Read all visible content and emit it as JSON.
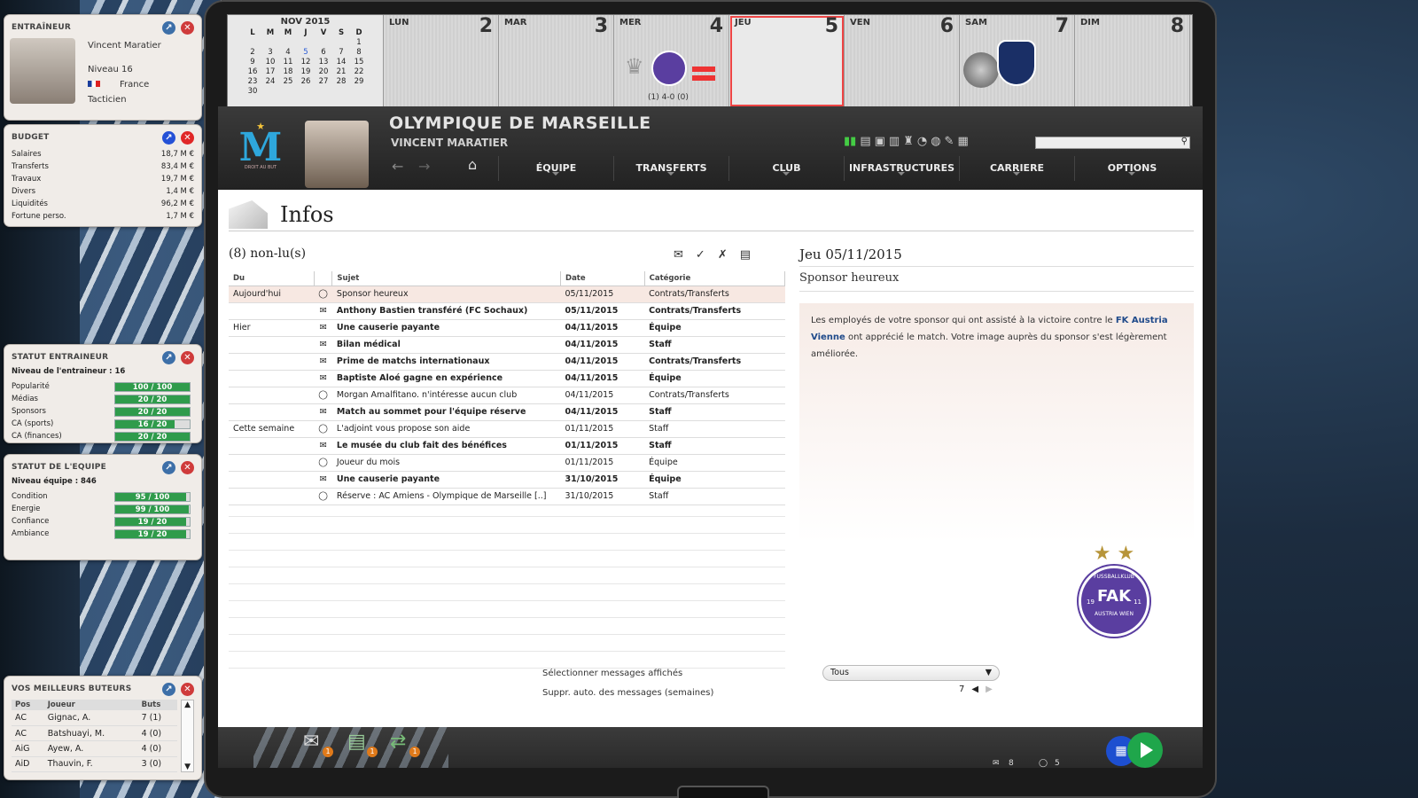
{
  "coach": {
    "title": "ENTRAÎNEUR",
    "name": "Vincent Maratier",
    "level": "Niveau 16",
    "country": "France",
    "role": "Tacticien"
  },
  "budget": {
    "title": "BUDGET",
    "rows": [
      {
        "label": "Salaires",
        "value": "18,7 M €"
      },
      {
        "label": "Transferts",
        "value": "83,4 M €"
      },
      {
        "label": "Travaux",
        "value": "19,7 M €"
      },
      {
        "label": "Divers",
        "value": "1,4 M €"
      },
      {
        "label": "Liquidités",
        "value": "96,2 M €"
      },
      {
        "label": "Fortune perso.",
        "value": "1,7 M €"
      }
    ]
  },
  "coach_status": {
    "title": "STATUT ENTRAINEUR",
    "subtitle": "Niveau de l'entraineur : 16",
    "rows": [
      {
        "label": "Popularité",
        "text": "100 / 100",
        "fraction": 1.0
      },
      {
        "label": "Médias",
        "text": "20 / 20",
        "fraction": 1.0
      },
      {
        "label": "Sponsors",
        "text": "20 / 20",
        "fraction": 1.0
      },
      {
        "label": "CA (sports)",
        "text": "16 / 20",
        "fraction": 0.8
      },
      {
        "label": "CA (finances)",
        "text": "20 / 20",
        "fraction": 1.0
      }
    ]
  },
  "team_status": {
    "title": "STATUT DE L'EQUIPE",
    "subtitle": "Niveau équipe : 846",
    "rows": [
      {
        "label": "Condition",
        "text": "95 / 100",
        "fraction": 0.95
      },
      {
        "label": "Energie",
        "text": "99 / 100",
        "fraction": 0.99
      },
      {
        "label": "Confiance",
        "text": "19 / 20",
        "fraction": 0.95
      },
      {
        "label": "Ambiance",
        "text": "19 / 20",
        "fraction": 0.95
      }
    ]
  },
  "scorers": {
    "title": "VOS MEILLEURS BUTEURS",
    "headers": [
      "Pos",
      "Joueur",
      "Buts"
    ],
    "rows": [
      {
        "pos": "AC",
        "name": "Gignac, A.",
        "goals": "7 (1)"
      },
      {
        "pos": "AC",
        "name": "Batshuayi, M.",
        "goals": "4 (0)"
      },
      {
        "pos": "AiG",
        "name": "Ayew, A.",
        "goals": "4 (0)"
      },
      {
        "pos": "AiD",
        "name": "Thauvin, F.",
        "goals": "3 (0)"
      }
    ]
  },
  "calendar": {
    "month": "NOV 2015",
    "weekdays": [
      "L",
      "M",
      "M",
      "J",
      "V",
      "S",
      "D"
    ],
    "weeks": [
      [
        "",
        "",
        "",
        "",
        "",
        "",
        "1"
      ],
      [
        "2",
        "3",
        "4",
        "5",
        "6",
        "7",
        "8"
      ],
      [
        "9",
        "10",
        "11",
        "12",
        "13",
        "14",
        "15"
      ],
      [
        "16",
        "17",
        "18",
        "19",
        "20",
        "21",
        "22"
      ],
      [
        "23",
        "24",
        "25",
        "26",
        "27",
        "28",
        "29"
      ],
      [
        "30",
        "",
        "",
        "",
        "",
        "",
        ""
      ]
    ],
    "days": [
      {
        "name": "LUN",
        "num": "2"
      },
      {
        "name": "MAR",
        "num": "3"
      },
      {
        "name": "MER",
        "num": "4"
      },
      {
        "name": "JEU",
        "num": "5"
      },
      {
        "name": "VEN",
        "num": "6"
      },
      {
        "name": "SAM",
        "num": "7"
      },
      {
        "name": "DIM",
        "num": "8"
      }
    ],
    "match_score": "(1) 4-0 (0)"
  },
  "header": {
    "club": "OLYMPIQUE DE MARSEILLE",
    "manager": "VINCENT MARATIER",
    "crest_text": "DROIT AU BUT",
    "nav": [
      "ÉQUIPE",
      "TRANSFERTS",
      "CLUB",
      "INFRASTRUCTURES",
      "CARRIERE",
      "OPTIONS"
    ]
  },
  "inbox": {
    "title": "Infos",
    "unread": "(8) non-lu(s)",
    "headers": [
      "Du",
      "Sujet",
      "Date",
      "Catégorie"
    ],
    "rows": [
      {
        "group": "Aujourd'hui",
        "icon": "◯",
        "subject": "Sponsor heureux",
        "date": "05/11/2015",
        "category": "Contrats/Transferts",
        "bold": false,
        "sel": true
      },
      {
        "group": "",
        "icon": "✉",
        "subject": "Anthony Bastien transféré (FC Sochaux)",
        "date": "05/11/2015",
        "category": "Contrats/Transferts",
        "bold": true
      },
      {
        "group": "Hier",
        "icon": "✉",
        "subject": "Une causerie payante",
        "date": "04/11/2015",
        "category": "Équipe",
        "bold": true
      },
      {
        "group": "",
        "icon": "✉",
        "subject": "Bilan médical",
        "date": "04/11/2015",
        "category": "Staff",
        "bold": true
      },
      {
        "group": "",
        "icon": "✉",
        "subject": "Prime de matchs internationaux",
        "date": "04/11/2015",
        "category": "Contrats/Transferts",
        "bold": true
      },
      {
        "group": "",
        "icon": "✉",
        "subject": "Baptiste Aloé gagne en expérience",
        "date": "04/11/2015",
        "category": "Équipe",
        "bold": true
      },
      {
        "group": "",
        "icon": "◯",
        "subject": "Morgan Amalfitano. n'intéresse aucun club",
        "date": "04/11/2015",
        "category": "Contrats/Transferts",
        "bold": false
      },
      {
        "group": "",
        "icon": "✉",
        "subject": "Match au sommet pour l'équipe réserve",
        "date": "04/11/2015",
        "category": "Staff",
        "bold": true
      },
      {
        "group": "Cette semaine",
        "icon": "◯",
        "subject": "L'adjoint vous propose son aide",
        "date": "01/11/2015",
        "category": "Staff",
        "bold": false
      },
      {
        "group": "",
        "icon": "✉",
        "subject": "Le musée du club fait des bénéfices",
        "date": "01/11/2015",
        "category": "Staff",
        "bold": true
      },
      {
        "group": "",
        "icon": "◯",
        "subject": "Joueur du mois",
        "date": "01/11/2015",
        "category": "Équipe",
        "bold": false
      },
      {
        "group": "",
        "icon": "✉",
        "subject": "Une causerie payante",
        "date": "31/10/2015",
        "category": "Équipe",
        "bold": true
      },
      {
        "group": "",
        "icon": "◯",
        "subject": "Réserve : AC Amiens - Olympique de Marseille [..]",
        "date": "31/10/2015",
        "category": "Staff",
        "bold": false
      }
    ],
    "opt_display": "Sélectionner messages affichés",
    "opt_display_value": "Tous",
    "opt_delete": "Suppr. auto. des messages (semaines)",
    "opt_delete_value": "7"
  },
  "reader": {
    "date": "Jeu 05/11/2015",
    "subject": "Sponsor heureux",
    "body_pre": "Les employés de votre sponsor qui ont assisté à la victoire contre le ",
    "body_link": "FK Austria Vienne",
    "body_post": " ont apprécié le match. Votre image auprès du sponsor s'est légèrement améliorée.",
    "logo_text_top": "FUSSBALLKLUB",
    "logo_text_bottom": "AUSTRIA WIEN",
    "logo_letters": "FAK",
    "logo_year_left": "19",
    "logo_year_right": "11"
  },
  "bottom": {
    "mail_count": "8",
    "news_count": "5",
    "badges": [
      "1",
      "1",
      "1"
    ]
  }
}
